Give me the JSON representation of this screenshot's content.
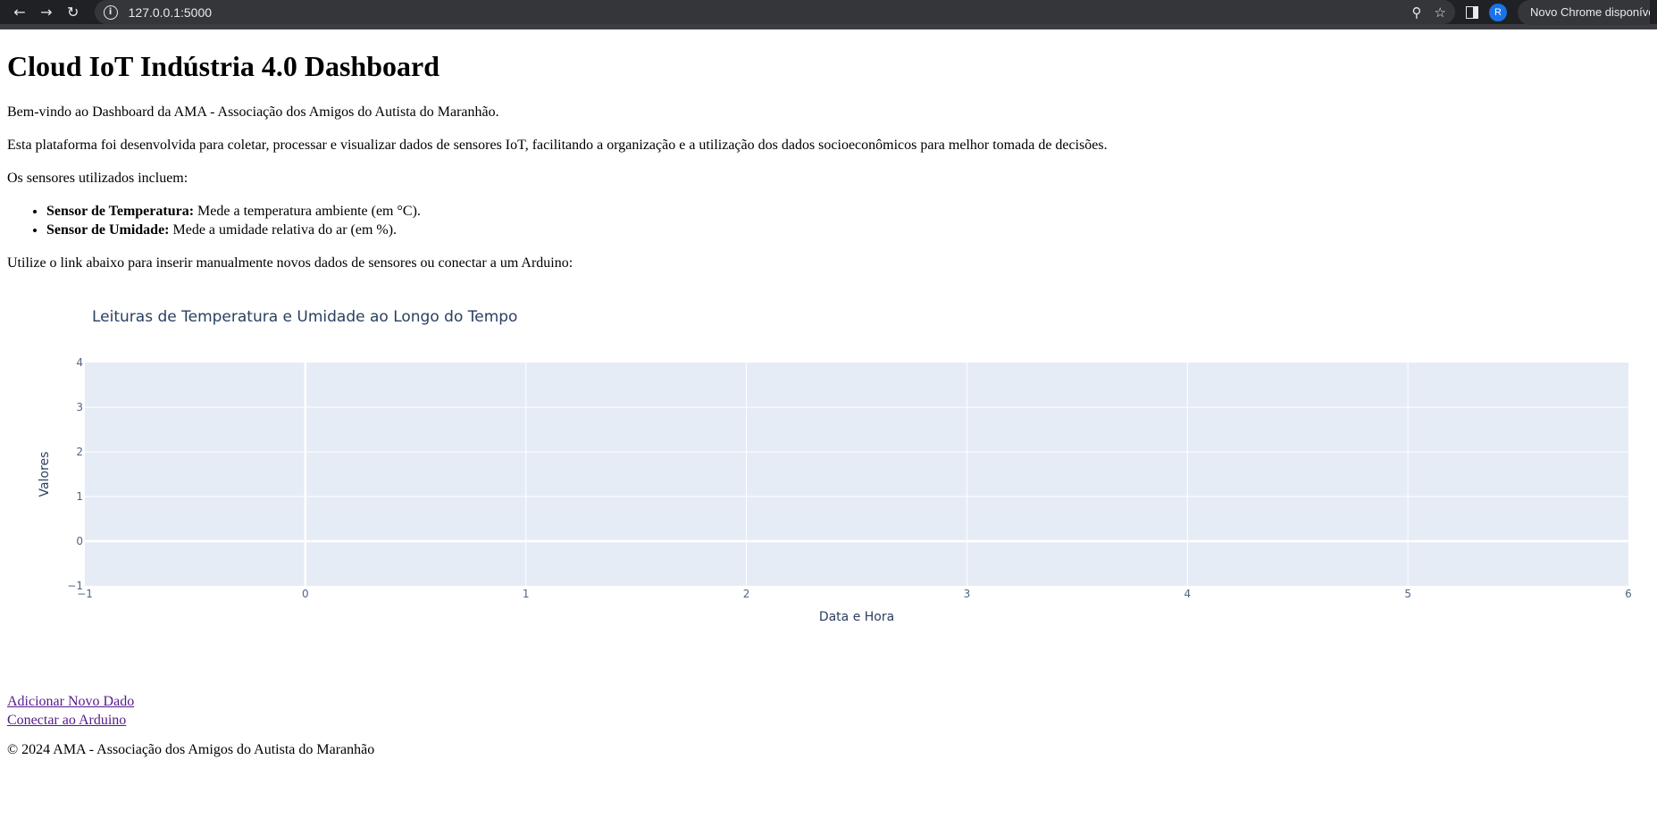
{
  "browser": {
    "url": "127.0.0.1:5000",
    "profile_initial": "R",
    "chrome_notice": "Novo Chrome disponível"
  },
  "page": {
    "title": "Cloud IoT Indústria 4.0 Dashboard",
    "welcome": "Bem-vindo ao Dashboard da AMA - Associação dos Amigos do Autista do Maranhão.",
    "description": "Esta plataforma foi desenvolvida para coletar, processar e visualizar dados de sensores IoT, facilitando a organização e a utilização dos dados socioeconômicos para melhor tomada de decisões.",
    "sensors_intro": "Os sensores utilizados incluem:",
    "sensors": [
      {
        "name": "Sensor de Temperatura:",
        "desc": " Mede a temperatura ambiente (em °C)."
      },
      {
        "name": "Sensor de Umidade:",
        "desc": " Mede a umidade relativa do ar (em %)."
      }
    ],
    "link_intro": "Utilize o link abaixo para inserir manualmente novos dados de sensores ou conectar a um Arduino:",
    "links": {
      "add_data": "Adicionar Novo Dado",
      "connect_arduino": "Conectar ao Arduino"
    },
    "footer": "© 2024 AMA - Associação dos Amigos do Autista do Maranhão"
  },
  "chart_data": {
    "type": "line",
    "title": "Leituras de Temperatura e Umidade ao Longo do Tempo",
    "xlabel": "Data e Hora",
    "ylabel": "Valores",
    "xlim": [
      -1,
      6
    ],
    "ylim": [
      -1,
      4
    ],
    "x_ticks": [
      "−1",
      "0",
      "1",
      "2",
      "3",
      "4",
      "5",
      "6"
    ],
    "y_ticks": [
      "−1",
      "0",
      "1",
      "2",
      "3",
      "4"
    ],
    "series": [],
    "grid": true,
    "plot_bg": "#e5ecf6",
    "text_color": "#2a3f5f",
    "tick_color": "#506784"
  }
}
